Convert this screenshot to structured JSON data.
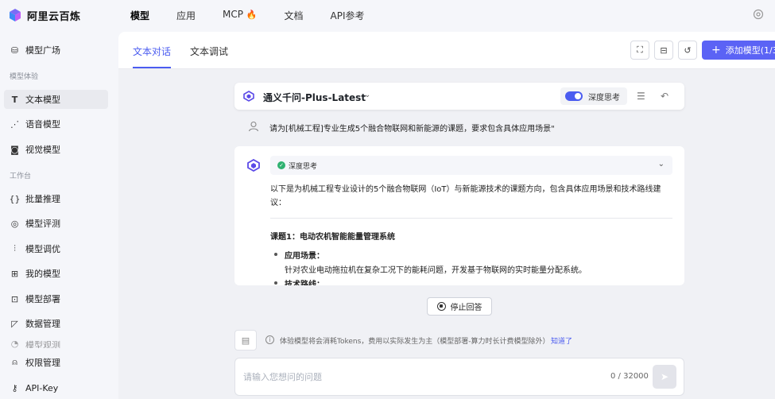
{
  "brand": {
    "name": "阿里云百炼"
  },
  "topnav": {
    "items": [
      {
        "label": "模型"
      },
      {
        "label": "应用"
      },
      {
        "label": "MCP"
      },
      {
        "label": "文档"
      },
      {
        "label": "API参考"
      }
    ]
  },
  "sidebar": {
    "model_square": "模型广场",
    "section_experience": "模型体验",
    "text_model": "文本模型",
    "voice_model": "语音模型",
    "vision_model": "视觉模型",
    "section_workbench": "工作台",
    "batch_inference": "批量推理",
    "model_eval": "模型评测",
    "model_tuning": "模型调优",
    "my_models": "我的模型",
    "model_deploy": "模型部署",
    "data_manage": "数据管理",
    "model_observe": "模型观测",
    "permission": "权限管理",
    "api_key": "API-Key"
  },
  "tabs": {
    "chat": "文本对话",
    "debug": "文本调试"
  },
  "header": {
    "add_model": "添加模型(1/3)"
  },
  "model": {
    "name": "通义千问-Plus-Latest",
    "deep_think": "深度思考"
  },
  "conversation": {
    "user_message": "请为[机械工程]专业生成5个融合物联网和新能源的课题，要求包含具体应用场景\"",
    "think_label": "深度思考",
    "intro": "以下是为机械工程专业设计的5个融合物联网（IoT）与新能源技术的课题方向，包含具体应用场景和技术路线建议：",
    "topic1_title": "课题1：电动农机智能能量管理系统",
    "bullet1_label": "应用场景：",
    "bullet1_desc": "针对农业电动拖拉机在复杂工况下的能耗问题，开发基于物联网的实时能量分配系统。",
    "bullet2_label": "技术路线："
  },
  "stop_label": "停止回答",
  "notice": {
    "text": "体验模型将会消耗Tokens，费用以实际发生为主（模型部署-算力时长计费模型除外）",
    "link": "知道了"
  },
  "input": {
    "placeholder": "请输入您想问的问题",
    "value": "",
    "counter": "0 / 32000"
  }
}
